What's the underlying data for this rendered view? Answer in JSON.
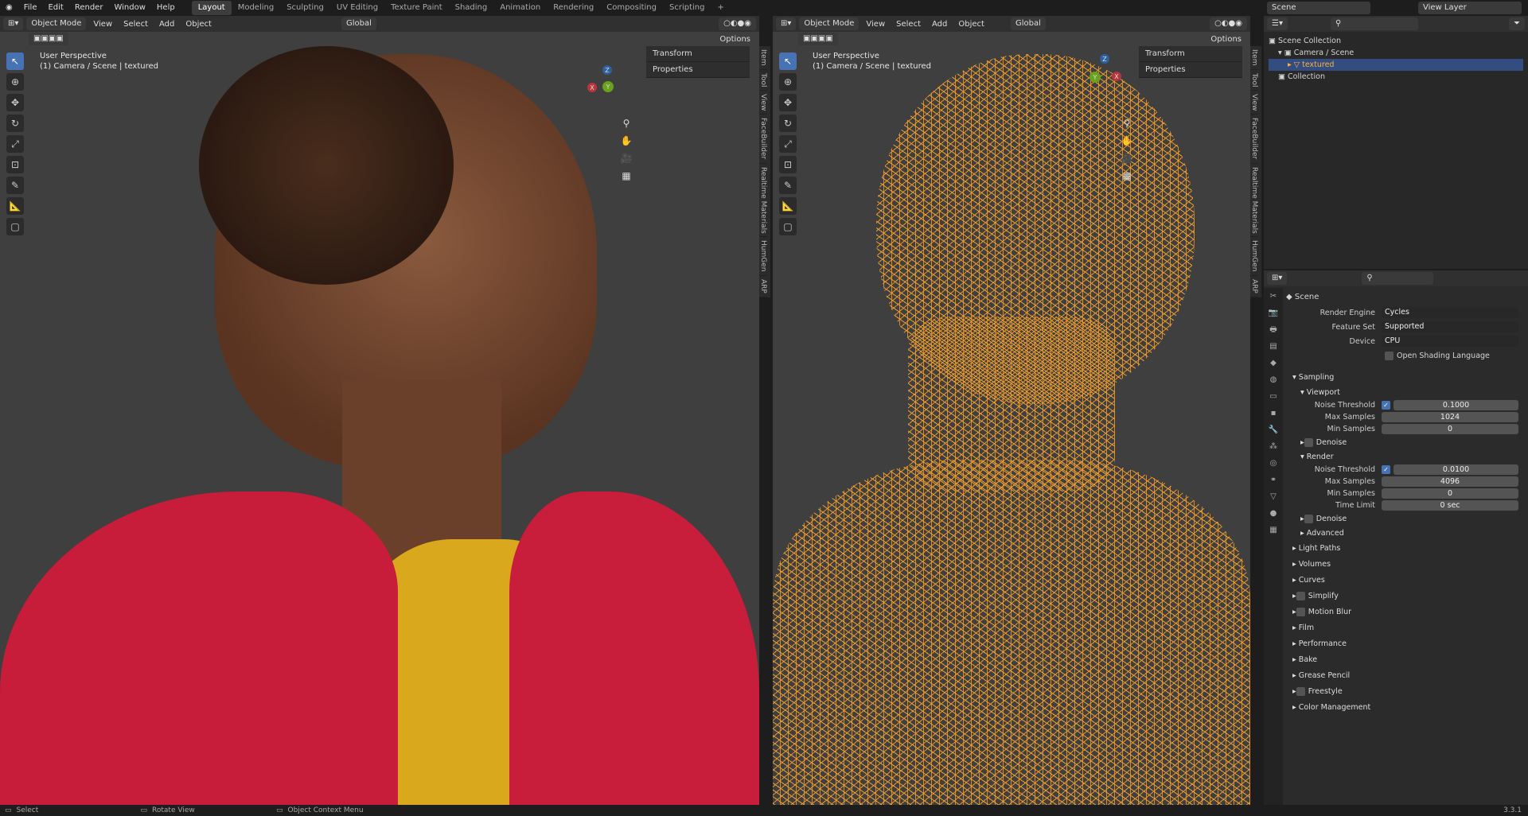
{
  "topbar": {
    "menus": [
      "File",
      "Edit",
      "Render",
      "Window",
      "Help"
    ],
    "workspaces": [
      "Layout",
      "Modeling",
      "Sculpting",
      "UV Editing",
      "Texture Paint",
      "Shading",
      "Animation",
      "Rendering",
      "Compositing",
      "Scripting"
    ],
    "active_workspace": "Layout",
    "add": "+",
    "scene": "Scene",
    "view_layer": "View Layer"
  },
  "viewport_left": {
    "mode": "Object Mode",
    "menus": [
      "View",
      "Select",
      "Add",
      "Object"
    ],
    "orientation": "Global",
    "options": "Options",
    "title": "User Perspective",
    "subtitle": "(1) Camera / Scene | textured",
    "npanel": [
      "Transform",
      "Properties"
    ],
    "tabs": [
      "Item",
      "Tool",
      "View",
      "FaceBuilder",
      "Realtime Materials",
      "HumGen",
      "ARP"
    ],
    "gizmo": {
      "x": "X",
      "y": "Y",
      "z": "Z"
    }
  },
  "viewport_right": {
    "mode": "Object Mode",
    "menus": [
      "View",
      "Select",
      "Add",
      "Object"
    ],
    "orientation": "Global",
    "options": "Options",
    "title": "User Perspective",
    "subtitle": "(1) Camera / Scene | textured",
    "npanel": [
      "Transform",
      "Properties"
    ],
    "tabs": [
      "Item",
      "Tool",
      "View",
      "FaceBuilder",
      "Realtime Materials",
      "HumGen",
      "ARP"
    ],
    "gizmo": {
      "x": "X",
      "y": "Y",
      "z": "Z"
    }
  },
  "outliner": {
    "root": "Scene Collection",
    "items": [
      {
        "label": "Camera / Scene"
      },
      {
        "label": "textured"
      },
      {
        "label": "Collection"
      }
    ]
  },
  "properties": {
    "context": "Scene",
    "render_engine_label": "Render Engine",
    "render_engine": "Cycles",
    "feature_set_label": "Feature Set",
    "feature_set": "Supported",
    "device_label": "Device",
    "device": "CPU",
    "osl": "Open Shading Language",
    "sampling": "Sampling",
    "viewport": "Viewport",
    "vp_noise_label": "Noise Threshold",
    "vp_noise": "0.1000",
    "vp_max_label": "Max Samples",
    "vp_max": "1024",
    "vp_min_label": "Min Samples",
    "vp_min": "0",
    "denoise": "Denoise",
    "render": "Render",
    "r_noise_label": "Noise Threshold",
    "r_noise": "0.0100",
    "r_max_label": "Max Samples",
    "r_max": "4096",
    "r_min_label": "Min Samples",
    "r_min": "0",
    "r_time_label": "Time Limit",
    "r_time": "0 sec",
    "denoise2": "Denoise",
    "advanced": "Advanced",
    "sections": [
      "Light Paths",
      "Volumes",
      "Curves",
      "Simplify",
      "Motion Blur",
      "Film",
      "Performance",
      "Bake",
      "Grease Pencil",
      "Freestyle",
      "Color Management"
    ]
  },
  "status": {
    "select": "Select",
    "rotate": "Rotate View",
    "context": "Object Context Menu",
    "version": "3.3.1"
  },
  "colors": {
    "accent": "#4772b3",
    "wire": "#f0a030",
    "selected": "#334d80"
  }
}
